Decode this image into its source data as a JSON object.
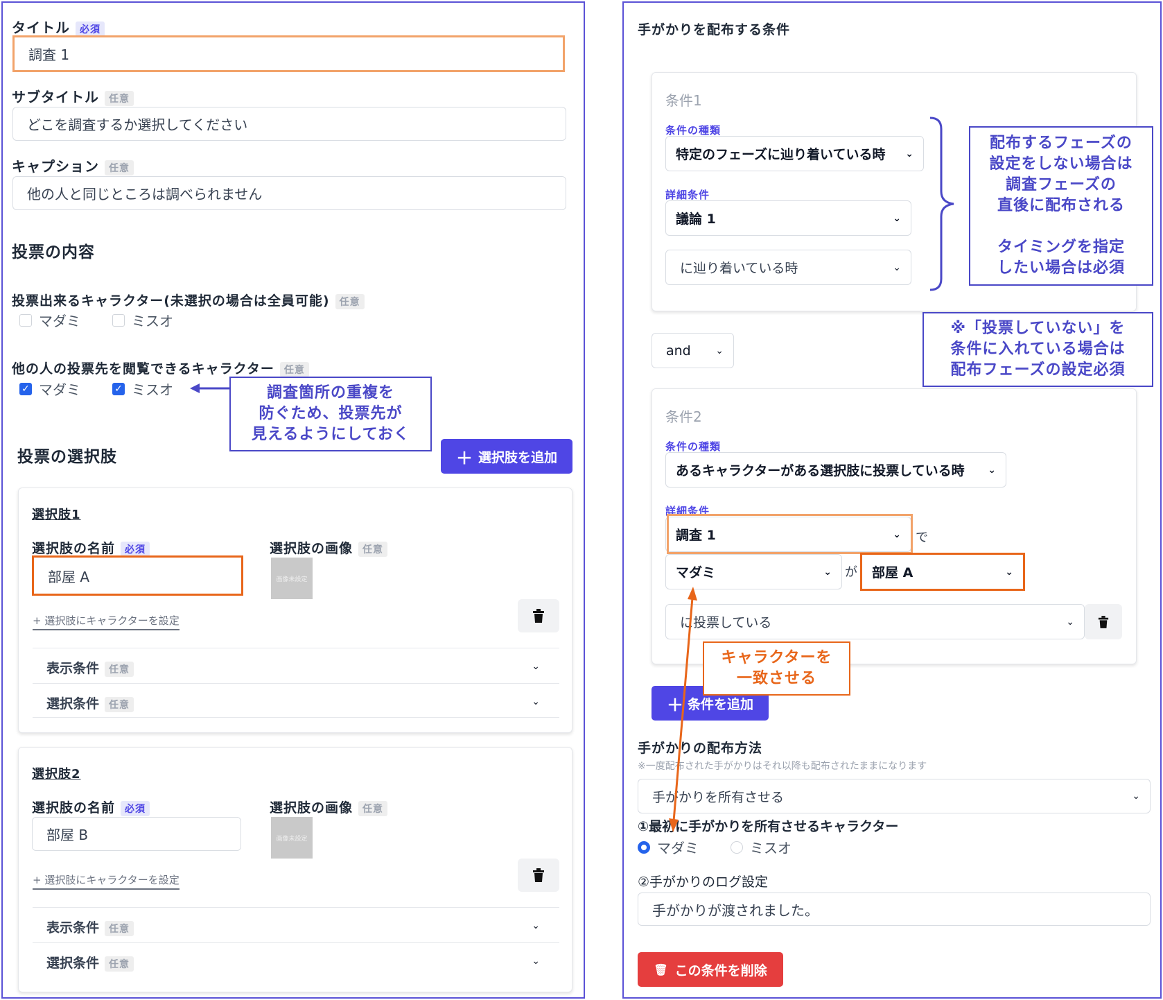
{
  "left": {
    "title_label": "タイトル",
    "title_tag": "必須",
    "title_value": "調査 1",
    "subtitle_label": "サブタイトル",
    "subtitle_tag": "任意",
    "subtitle_value": "どこを調査するか選択してください",
    "caption_label": "キャプション",
    "caption_tag": "任意",
    "caption_value": "他の人と同じところは調べられません",
    "vote_section": "投票の内容",
    "voters_label": "投票出来るキャラクター(未選択の場合は全員可能)",
    "voters_tag": "任意",
    "voters": [
      "マダミ",
      "ミスオ"
    ],
    "viewers_label": "他の人の投票先を閲覧できるキャラクター",
    "viewers_tag": "任意",
    "viewers": [
      "マダミ",
      "ミスオ"
    ],
    "choices_heading": "投票の選択肢",
    "add_choice_button": "選択肢を追加",
    "choices": [
      {
        "heading": "選択肢1",
        "name_label": "選択肢の名前",
        "name_tag": "必須",
        "name_value": "部屋 A",
        "image_label": "選択肢の画像",
        "image_tag": "任意",
        "image_placeholder": "画像未設定",
        "set_character": "+ 選択肢にキャラクターを設定",
        "display_cond": "表示条件",
        "display_tag": "任意",
        "select_cond": "選択条件",
        "select_tag": "任意"
      },
      {
        "heading": "選択肢2",
        "name_label": "選択肢の名前",
        "name_tag": "必須",
        "name_value": "部屋 B",
        "image_label": "選択肢の画像",
        "image_tag": "任意",
        "image_placeholder": "画像未設定",
        "set_character": "+ 選択肢にキャラクターを設定",
        "display_cond": "表示条件",
        "display_tag": "任意",
        "select_cond": "選択条件",
        "select_tag": "任意"
      }
    ],
    "callout_viewers": "調査箇所の重複を\n防ぐため、投票先が\n見えるようにしておく"
  },
  "right": {
    "heading": "手がかりを配布する条件",
    "cond1": {
      "title": "条件1",
      "type_label": "条件の種類",
      "type_value": "特定のフェーズに辿り着いている時",
      "detail_label": "詳細条件",
      "detail_value": "議論 1",
      "state_value": "に辿り着いている時"
    },
    "connector": "and",
    "cond2": {
      "title": "条件2",
      "type_label": "条件の種類",
      "type_value": "あるキャラクターがある選択肢に投票している時",
      "detail_label": "詳細条件",
      "detail_value": "調査 1",
      "detail_suffix": "で",
      "character_value": "マダミ",
      "character_suffix": "が",
      "choice_value": "部屋 A",
      "state_value": "に投票している"
    },
    "add_condition_button": "条件を追加",
    "distribution_heading": "手がかりの配布方法",
    "distribution_note": "※一度配布された手がかりはそれ以降も配布されたままになります",
    "distribution_value": "手がかりを所有させる",
    "owner_label": "①最初に手がかりを所有させるキャラクター",
    "owners": [
      "マダミ",
      "ミスオ"
    ],
    "log_label": "②手がかりのログ設定",
    "log_value": "手がかりが渡されました。",
    "delete_button": "この条件を削除",
    "callout_phase": "配布するフェーズの\n設定をしない場合は\n調査フェーズの\n直後に配布される\n\nタイミングを指定\nしたい場合は必須",
    "callout_novote": "※「投票していない」を\n条件に入れている場合は\n配布フェーズの設定必須",
    "callout_match": "キャラクターを\n一致させる"
  },
  "colors": {
    "accent": "#4f46e5",
    "highlight_orange": "#e8661a",
    "highlight_light_orange": "#f2a36a",
    "danger": "#e53e3e",
    "checkbox_blue": "#2563eb"
  }
}
